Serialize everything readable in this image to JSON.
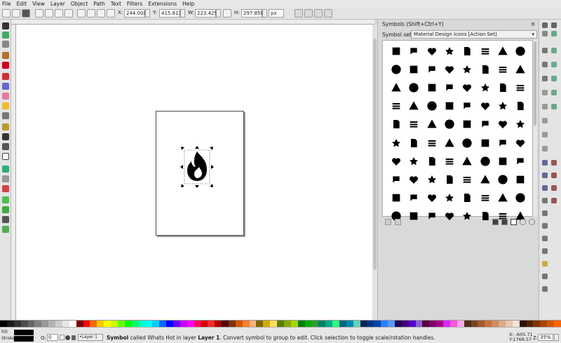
{
  "menu": [
    "File",
    "Edit",
    "View",
    "Layer",
    "Object",
    "Path",
    "Text",
    "Filters",
    "Extensions",
    "Help"
  ],
  "toolbar": {
    "x_label": "X:",
    "x_value": "244.000",
    "y_label": "Y:",
    "y_value": "415.813",
    "w_label": "W:",
    "w_value": "223.429",
    "h_label": "H:",
    "h_value": "297.858",
    "unit": "px"
  },
  "symbols_dock": {
    "title": "Symbols (Shift+Ctrl+Y)",
    "close": "×",
    "set_label": "Symbol set:",
    "set_value": "Material Design Icons [Action Set]",
    "icons": [
      "3d-rotation",
      "accessibility",
      "account-balance",
      "account-balance-wallet",
      "account-box",
      "supervisor-account",
      "account-circle",
      "add-shopping-cart",
      "alarm",
      "alarm-add",
      "alarm-off",
      "alarm-on",
      "android",
      "announcement",
      "aspect-ratio",
      "assessment",
      "assignment",
      "assignment-ind",
      "assignment-late",
      "assignment-return",
      "assignment-returned",
      "autorenew",
      "backup",
      "book",
      "bookmark",
      "bookmark-border",
      "bug-report",
      "cached",
      "class",
      "credit-card",
      "dashboard",
      "delete",
      "description",
      "dns",
      "done",
      "done-all",
      "event",
      "exit-to-app",
      "explore",
      "extension",
      "face",
      "favorite",
      "help",
      "history",
      "find-replace",
      "flip-to-front",
      "flip-to-back",
      "get-app",
      "grade",
      "group-work",
      "help-circle",
      "highlight-off",
      "restore",
      "home",
      "https",
      "info",
      "info-outline",
      "input",
      "invert-colors",
      "label",
      "label-outline",
      "language",
      "launch",
      "list",
      "lock",
      "lock-open",
      "lock-outline",
      "loyalty",
      "markunread-mailbox",
      "note-add",
      "open-in-browser",
      "open-in-new",
      "open-with",
      "pageview",
      "payment",
      "perm-camera-mic",
      "perm-contact-calendar",
      "perm-data-setting",
      "perm-device-information",
      "perm-identity"
    ]
  },
  "status": {
    "fill_label": "Fill:",
    "stroke_label": "Stroke:",
    "opacity_label": "O:",
    "opacity_value": "0",
    "layer": "•Layer 1",
    "message_bold": "Symbol",
    "message_1": " called Whats Hot in layer ",
    "message_layer": "Layer 1",
    "message_2": ". Convert symbol to group to edit. Click selection to toggle scale/rotation handles.",
    "x_coord": "X: -605.71",
    "y_coord": "Y:1768.57",
    "zoom_label": "Z:",
    "zoom_value": "35%"
  },
  "colors": {
    "accent_swatch": "#ff0000",
    "selection_handle": "#000000"
  }
}
